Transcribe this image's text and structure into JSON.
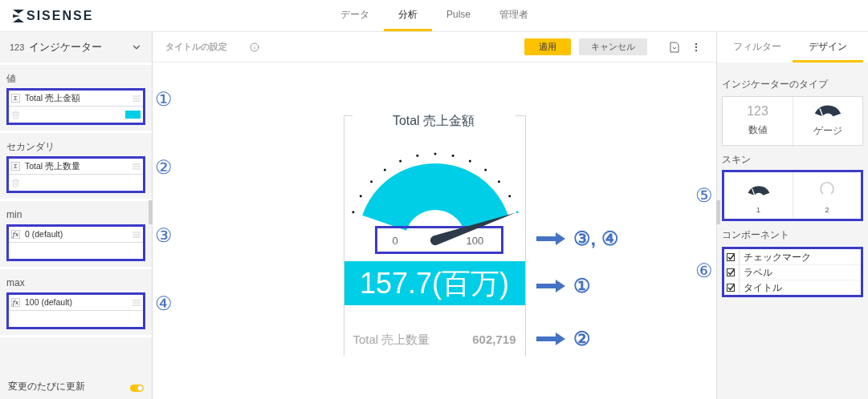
{
  "logo": "SISENSE",
  "nav": [
    {
      "label": "データ",
      "selected": false
    },
    {
      "label": "分析",
      "selected": true
    },
    {
      "label": "Pulse",
      "selected": false
    },
    {
      "label": "管理者",
      "selected": false
    }
  ],
  "left_panel": {
    "widget_type": {
      "icon_text": "123",
      "label": "インジケーター"
    },
    "sections": [
      {
        "title": "値",
        "field": {
          "icon": "Σ",
          "label": "Total 売上金額",
          "deletable": true,
          "color": "#00cee6"
        },
        "callout": "①"
      },
      {
        "title": "セカンダリ",
        "field": {
          "icon": "Σ",
          "label": "Total 売上数量",
          "deletable": true
        },
        "callout": "②"
      },
      {
        "title": "min",
        "field": {
          "icon": "fx",
          "label": "0 (default)",
          "deletable": false
        },
        "callout": "③"
      },
      {
        "title": "max",
        "field": {
          "icon": "fx",
          "label": "100 (default)",
          "deletable": false
        },
        "callout": "④"
      }
    ],
    "auto_update": {
      "label": "変更のたびに更新",
      "on": true
    }
  },
  "toolbar": {
    "title_placeholder": "タイトルの設定",
    "buttons": [
      {
        "label": "適用",
        "kind": "primary"
      },
      {
        "label": "キャンセル",
        "kind": "secondary"
      }
    ]
  },
  "indicator": {
    "title": "Total 売上金額",
    "gauge": {
      "level": 1,
      "min": "0",
      "max": "100",
      "callout": "③, ④"
    },
    "value": {
      "text": "157.7(百万)",
      "color": "#00cee6",
      "callout": "①"
    },
    "secondary": {
      "label": "Total 売上数量",
      "value": "602,719",
      "callout": "②"
    }
  },
  "right_panel": {
    "tabs": [
      {
        "label": "フィルター",
        "selected": false
      },
      {
        "label": "デザイン",
        "selected": true
      }
    ],
    "type_section": {
      "title": "インジケーターのタイプ",
      "options": [
        {
          "kind": "number",
          "icon_text": "123",
          "label": "数値"
        },
        {
          "kind": "gauge",
          "label": "ゲージ"
        }
      ]
    },
    "skin_section": {
      "title": "スキン",
      "callout": "⑤",
      "options": [
        {
          "kind": "fan",
          "label": "1"
        },
        {
          "kind": "ring",
          "label": "2"
        }
      ]
    },
    "components": {
      "title": "コンポーネント",
      "callout": "⑥",
      "items": [
        {
          "label": "チェックマーク",
          "checked": true
        },
        {
          "label": "ラベル",
          "checked": true
        },
        {
          "label": "タイトル",
          "checked": true
        }
      ]
    }
  }
}
